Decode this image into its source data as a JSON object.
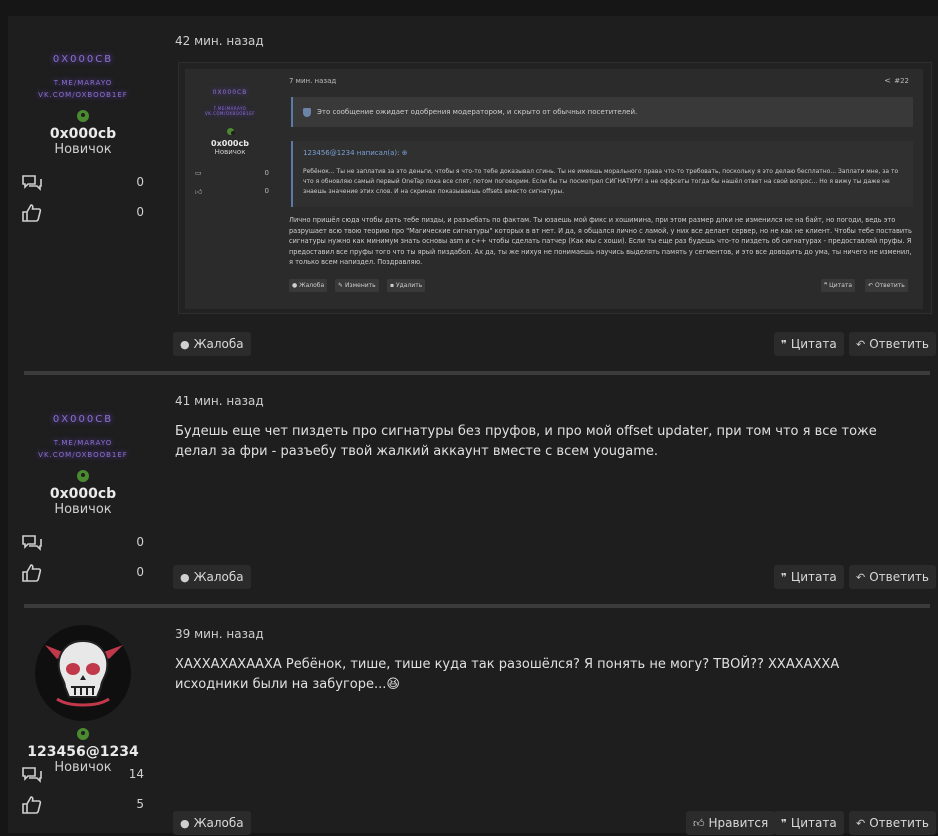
{
  "posts": [
    {
      "time": "42 мин. назад",
      "user": {
        "banner_lines": [
          "0X000CB",
          "T.ME/MARAYO",
          "VK.COM/OXBOOB1EF"
        ],
        "name": "0x000cb",
        "role": "Новичок",
        "messages": "0",
        "reactions": "0"
      },
      "embedded_screenshot": {
        "time": "7 мин. назад",
        "post_number": "#22",
        "user": {
          "banner_lines": [
            "0X000CB",
            "T.ME/MARAYO",
            "VK.COM/OXBOOB1EF"
          ],
          "name": "0x000cb",
          "role": "Новичок",
          "messages": "0",
          "reactions": "0"
        },
        "notice": "Это сообщение ожидает одобрения модератором, и скрыто от обычных посетителей.",
        "quote_author": "123456@1234 написал(а): ⊕",
        "quote_text": "Ребёнок... Ты не заплатив за это деньги, чтобы я что-то тебе доказывал сгинь. Ты не имеешь морального права что-то требовать, поскольку я это делаю бесплатно... Заплати мне, за то что я обновляю самый первый OneTap пока все спят, потом поговорим. Если бы ты посмотрел СИГНАТУРУ! а не оффсеты тогда бы нашёл ответ на свой вопрос... Но я вижу ты даже не знаешь значение этих слов. И на скринах показываешь offsets вместо сигнатуры.",
        "body": "Лично пришёл сюда чтобы дать тебе пизды, и разъебать по фактам. Ты юзаешь мой фикс и хошимина, при этом размер длки не изменился не на байт, но погоди, ведь это разрушает всю твою теорию про \"Магические сигнатуры\" которых в вт нет. И да, я общался лично с ламой, у них все делает сервер, но не как не клиент. Чтобы тебе поставить сигнатуры нужно как минимум знать основы asm и c++ чтобы сделать патчер (Как мы с хоши). Если ты еще раз будешь что-то пиздеть об сигнатурах - предоставляй пруфы. Я предоставил все пруфы того что ты ярый пиздабол. Ах да, ты же нихуя не понимаешь научись выделять память у сегментов, и это все доводить до ума, ты ничего не изменил, я только всем напиздел. Поздравляю.",
        "buttons": {
          "report": "Жалоба",
          "edit": "Изменить",
          "delete": "Удалить",
          "quote": "Цитата",
          "reply": "Ответить"
        }
      },
      "buttons": {
        "report": "Жалоба",
        "quote": "Цитата",
        "reply": "Ответить"
      }
    },
    {
      "time": "41 мин. назад",
      "user": {
        "banner_lines": [
          "0X000CB",
          "T.ME/MARAYO",
          "VK.COM/OXBOOB1EF"
        ],
        "name": "0x000cb",
        "role": "Новичок",
        "messages": "0",
        "reactions": "0"
      },
      "text": "Будешь еще чет пиздеть про сигнатуры без пруфов, и про мой offset updater, при том что я все тоже делал за фри - разъебу твой жалкий аккаунт вместе с всем yougame.",
      "buttons": {
        "report": "Жалоба",
        "quote": "Цитата",
        "reply": "Ответить"
      }
    },
    {
      "time": "39 мин. назад",
      "user": {
        "name": "123456@1234",
        "role": "Новичок",
        "messages": "14",
        "reactions": "5"
      },
      "text": "ХАХХАХАХААХА Ребёнок, тише, тише куда так разошёлся? Я понять не могу? ТВОЙ?? ХХАХАХХА исходники были на забугоре...",
      "emoji": "😆",
      "buttons": {
        "report": "Жалоба",
        "like": "Нравится",
        "quote": "Цитата",
        "reply": "Ответить"
      }
    }
  ],
  "colors": {
    "background": "#1e1e1e",
    "button_bg": "#2b2b2b",
    "banner_glow": "#8a6fd1",
    "online": "#4b8a30",
    "quote_accent": "#5a7aa8"
  }
}
